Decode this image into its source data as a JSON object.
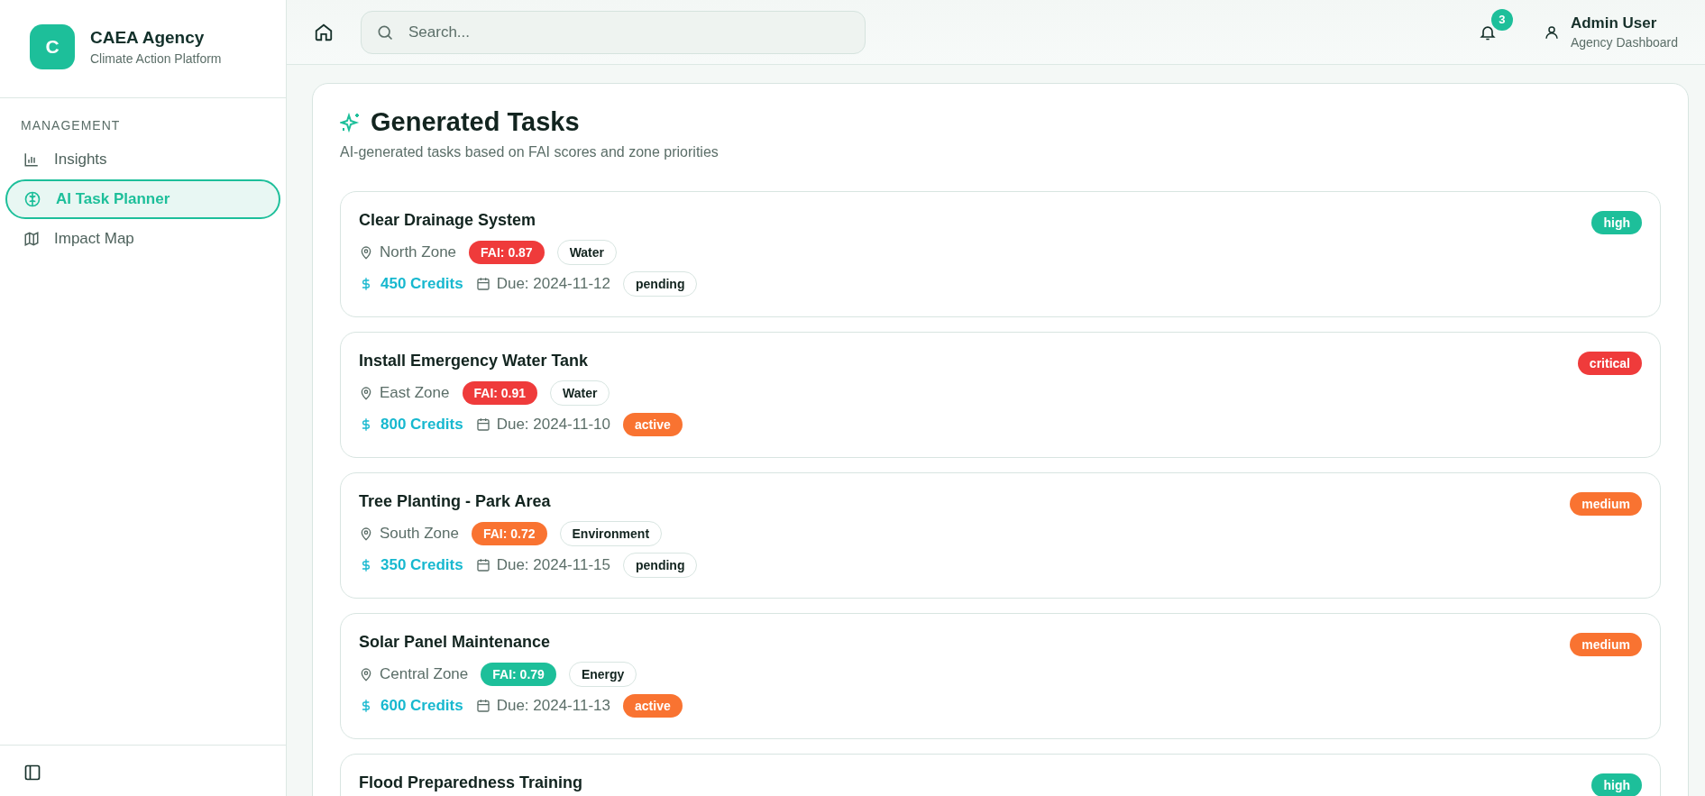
{
  "sidebar": {
    "logo_letter": "C",
    "brand": "CAEA Agency",
    "tagline": "Climate Action Platform",
    "section_label": "MANAGEMENT",
    "items": [
      {
        "label": "Insights",
        "kind": "chart",
        "selected": false
      },
      {
        "label": "AI Task Planner",
        "kind": "brain",
        "selected": true
      },
      {
        "label": "Impact Map",
        "kind": "map",
        "selected": false
      }
    ]
  },
  "header": {
    "search": {
      "placeholder": "Search..."
    },
    "notifications": "3",
    "user": {
      "name": "Admin User",
      "role": "Agency Dashboard"
    }
  },
  "page": {
    "title": "Generated Tasks",
    "subtitle": "AI-generated tasks based on FAI scores and zone priorities"
  },
  "tasks": [
    {
      "title": "Clear Drainage System",
      "priority": {
        "label": "high",
        "color": "#1dbf9a"
      },
      "zone": "North Zone",
      "fai": {
        "label": "FAI: 0.87",
        "color": "#ef3b3b"
      },
      "category": "Water",
      "credits": "450 Credits",
      "due": "Due: 2024-11-12",
      "status": {
        "label": "pending",
        "highlighted": false
      }
    },
    {
      "title": "Install Emergency Water Tank",
      "priority": {
        "label": "critical",
        "color": "#ef3b3b"
      },
      "zone": "East Zone",
      "fai": {
        "label": "FAI: 0.91",
        "color": "#ef3b3b"
      },
      "category": "Water",
      "credits": "800 Credits",
      "due": "Due: 2024-11-10",
      "status": {
        "label": "active",
        "highlighted": true
      }
    },
    {
      "title": "Tree Planting - Park Area",
      "priority": {
        "label": "medium",
        "color": "#f97331"
      },
      "zone": "South Zone",
      "fai": {
        "label": "FAI: 0.72",
        "color": "#f97331"
      },
      "category": "Environment",
      "credits": "350 Credits",
      "due": "Due: 2024-11-15",
      "status": {
        "label": "pending",
        "highlighted": false
      }
    },
    {
      "title": "Solar Panel Maintenance",
      "priority": {
        "label": "medium",
        "color": "#f97331"
      },
      "zone": "Central Zone",
      "fai": {
        "label": "FAI: 0.79",
        "color": "#1dbf9a"
      },
      "category": "Energy",
      "credits": "600 Credits",
      "due": "Due: 2024-11-13",
      "status": {
        "label": "active",
        "highlighted": true
      }
    },
    {
      "title": "Flood Preparedness Training",
      "priority": {
        "label": "high",
        "color": "#1dbf9a"
      }
    }
  ]
}
